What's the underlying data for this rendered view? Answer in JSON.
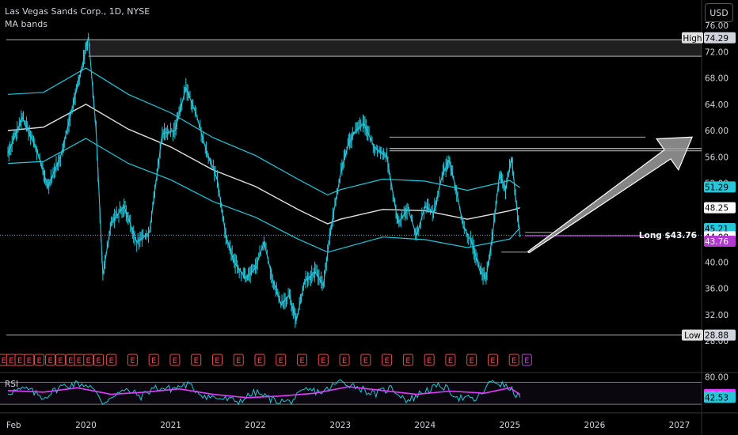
{
  "header": {
    "title": "Las Vegas Sands Corp., 1D, NYSE",
    "indicator": "MA bands",
    "currency_button": "USD"
  },
  "chart_data": {
    "type": "line",
    "instrument": "Las Vegas Sands Corp.",
    "interval": "1D",
    "exchange": "NYSE",
    "x_ticks": [
      "Feb",
      "2020",
      "2021",
      "2022",
      "2023",
      "2024",
      "2025",
      "2026",
      "2027"
    ],
    "y_ticks": [
      28.0,
      32.0,
      36.0,
      40.0,
      44.0,
      48.0,
      52.0,
      56.0,
      60.0,
      64.0,
      68.0,
      72.0,
      76.0
    ],
    "ylim": [
      27.5,
      78.5
    ],
    "price_series": {
      "name": "",
      "color": "#26c6da",
      "points": [
        [
          2019.08,
          56.5
        ],
        [
          2019.25,
          62.0
        ],
        [
          2019.42,
          57.0
        ],
        [
          2019.55,
          51.5
        ],
        [
          2019.7,
          56.0
        ],
        [
          2019.85,
          64.0
        ],
        [
          2019.96,
          70.0
        ],
        [
          2020.03,
          74.29
        ],
        [
          2020.12,
          60.0
        ],
        [
          2020.2,
          38.0
        ],
        [
          2020.3,
          46.0
        ],
        [
          2020.45,
          48.5
        ],
        [
          2020.6,
          43.0
        ],
        [
          2020.75,
          44.5
        ],
        [
          2020.9,
          59.5
        ],
        [
          2021.05,
          60.0
        ],
        [
          2021.18,
          66.5
        ],
        [
          2021.3,
          62.5
        ],
        [
          2021.42,
          57.0
        ],
        [
          2021.55,
          52.5
        ],
        [
          2021.65,
          44.0
        ],
        [
          2021.75,
          40.0
        ],
        [
          2021.88,
          37.5
        ],
        [
          2022.0,
          39.0
        ],
        [
          2022.1,
          43.0
        ],
        [
          2022.2,
          37.5
        ],
        [
          2022.3,
          33.5
        ],
        [
          2022.4,
          35.0
        ],
        [
          2022.48,
          31.0
        ],
        [
          2022.58,
          37.0
        ],
        [
          2022.7,
          38.5
        ],
        [
          2022.8,
          36.5
        ],
        [
          2022.9,
          46.0
        ],
        [
          2023.02,
          54.5
        ],
        [
          2023.1,
          58.0
        ],
        [
          2023.18,
          60.0
        ],
        [
          2023.28,
          61.0
        ],
        [
          2023.4,
          57.5
        ],
        [
          2023.55,
          56.0
        ],
        [
          2023.68,
          46.0
        ],
        [
          2023.8,
          48.0
        ],
        [
          2023.9,
          44.0
        ],
        [
          2024.0,
          48.5
        ],
        [
          2024.1,
          47.5
        ],
        [
          2024.2,
          53.0
        ],
        [
          2024.28,
          55.5
        ],
        [
          2024.36,
          51.5
        ],
        [
          2024.45,
          45.5
        ],
        [
          2024.55,
          43.0
        ],
        [
          2024.65,
          38.5
        ],
        [
          2024.72,
          37.5
        ],
        [
          2024.8,
          44.5
        ],
        [
          2024.88,
          53.5
        ],
        [
          2024.95,
          51.0
        ],
        [
          2025.02,
          56.0
        ],
        [
          2025.08,
          48.5
        ],
        [
          2025.12,
          43.76
        ]
      ]
    },
    "ma_bands": {
      "color_mid": "#e0e0e0",
      "color_band": "#26c6da",
      "points": [
        [
          2019.08,
          60.0,
          65.5,
          55.0
        ],
        [
          2019.5,
          60.5,
          65.8,
          55.3
        ],
        [
          2020.0,
          64.0,
          69.5,
          58.8
        ],
        [
          2020.5,
          60.2,
          65.5,
          55.0
        ],
        [
          2021.0,
          57.5,
          62.7,
          52.5
        ],
        [
          2021.5,
          54.0,
          58.9,
          49.2
        ],
        [
          2022.0,
          51.5,
          56.2,
          46.8
        ],
        [
          2022.5,
          48.0,
          52.6,
          43.5
        ],
        [
          2022.85,
          45.8,
          50.2,
          41.5
        ],
        [
          2023.0,
          46.5,
          51.0,
          42.0
        ],
        [
          2023.5,
          48.0,
          52.6,
          43.8
        ],
        [
          2024.0,
          47.8,
          52.3,
          43.4
        ],
        [
          2024.5,
          46.5,
          50.9,
          42.2
        ],
        [
          2025.0,
          47.8,
          52.4,
          43.5
        ],
        [
          2025.12,
          48.25,
          51.29,
          45.21
        ]
      ]
    },
    "horizontal_lines": [
      {
        "y": 73.8,
        "x_start": 2019.06,
        "x_end": 2027.3,
        "color": "#b0b0b0"
      },
      {
        "y": 71.3,
        "x_start": 2020.03,
        "x_end": 2027.3,
        "color": "#b0b0b0"
      },
      {
        "y": 59.0,
        "x_start": 2023.58,
        "x_end": 2026.6,
        "color": "#b0b0b0"
      },
      {
        "y": 57.3,
        "x_start": 2023.58,
        "x_end": 2027.3,
        "color": "#b0b0b0"
      },
      {
        "y": 56.9,
        "x_start": 2023.58,
        "x_end": 2027.3,
        "color": "#b0b0b0"
      },
      {
        "y": 44.5,
        "x_start": 2025.18,
        "x_end": 2025.5,
        "color": "#b0b0b0"
      },
      {
        "y": 41.5,
        "x_start": 2024.9,
        "x_end": 2025.25,
        "color": "#b0b0b0"
      },
      {
        "y": 28.88,
        "x_start": 2019.06,
        "x_end": 2027.3,
        "color": "#b0b0b0"
      }
    ],
    "current_price_line": {
      "y": 44.08,
      "color": "#26c6da"
    },
    "arrow": {
      "from": [
        2025.22,
        41.5
      ],
      "to": [
        2027.15,
        59.0
      ],
      "color": "#9e9e9e"
    },
    "position_marker": {
      "label": "Long $43.76",
      "y": 43.76,
      "x_start": 2025.18,
      "x_end": 2026.6,
      "color": "#b23ad3"
    },
    "price_labels": [
      {
        "value": "74.29",
        "prefix": "High",
        "bg": "#d1d4dc",
        "fg": "#000000"
      },
      {
        "value": "51.29",
        "prefix": "",
        "bg": "#26c6da",
        "fg": "#000000"
      },
      {
        "value": "48.25",
        "prefix": "",
        "bg": "#ffffff",
        "fg": "#000000"
      },
      {
        "value": "45.21",
        "prefix": "",
        "bg": "#26c6da",
        "fg": "#000000"
      },
      {
        "value": "44.08",
        "prefix": "",
        "bg": "#ffffff",
        "fg": "#000000"
      },
      {
        "value": "43.76",
        "prefix": "",
        "bg": "#b23ad3",
        "fg": "#ffffff"
      },
      {
        "value": "28.88",
        "prefix": "Low",
        "bg": "#d1d4dc",
        "fg": "#000000"
      }
    ],
    "earnings_markers": {
      "label": "E",
      "color": "#e05050",
      "highlight_color": "#c040e0",
      "x": [
        2019.03,
        2019.12,
        2019.22,
        2019.33,
        2019.45,
        2019.58,
        2019.7,
        2019.82,
        2019.92,
        2020.03,
        2020.15,
        2020.3,
        2020.55,
        2020.8,
        2021.05,
        2021.3,
        2021.55,
        2021.8,
        2022.05,
        2022.3,
        2022.55,
        2022.8,
        2023.05,
        2023.3,
        2023.55,
        2023.8,
        2024.05,
        2024.3,
        2024.55,
        2024.8,
        2025.05,
        2025.2
      ],
      "highlight_last": true
    },
    "rsi": {
      "label": "RSI",
      "y_ticks": [
        80.0
      ],
      "ylim": [
        20,
        85
      ],
      "levels": [
        70,
        30
      ],
      "rsi_color": "#26c6da",
      "ma_color": "#e040fb",
      "points": [
        [
          2019.08,
          52
        ],
        [
          2019.3,
          58
        ],
        [
          2019.5,
          42
        ],
        [
          2019.7,
          62
        ],
        [
          2019.9,
          68
        ],
        [
          2020.05,
          64
        ],
        [
          2020.2,
          32
        ],
        [
          2020.35,
          50
        ],
        [
          2020.5,
          55
        ],
        [
          2020.65,
          44
        ],
        [
          2020.8,
          60
        ],
        [
          2021.0,
          58
        ],
        [
          2021.2,
          66
        ],
        [
          2021.4,
          45
        ],
        [
          2021.6,
          40
        ],
        [
          2021.8,
          35
        ],
        [
          2022.0,
          52
        ],
        [
          2022.2,
          38
        ],
        [
          2022.4,
          34
        ],
        [
          2022.6,
          56
        ],
        [
          2022.8,
          52
        ],
        [
          2023.0,
          72
        ],
        [
          2023.2,
          62
        ],
        [
          2023.4,
          48
        ],
        [
          2023.6,
          60
        ],
        [
          2023.8,
          36
        ],
        [
          2024.0,
          55
        ],
        [
          2024.2,
          64
        ],
        [
          2024.4,
          42
        ],
        [
          2024.6,
          38
        ],
        [
          2024.8,
          74
        ],
        [
          2025.0,
          58
        ],
        [
          2025.12,
          42.53
        ]
      ],
      "ma_points": [
        [
          2019.08,
          55
        ],
        [
          2019.5,
          52
        ],
        [
          2019.9,
          60
        ],
        [
          2020.3,
          48
        ],
        [
          2020.7,
          52
        ],
        [
          2021.1,
          58
        ],
        [
          2021.5,
          48
        ],
        [
          2021.9,
          42
        ],
        [
          2022.3,
          45
        ],
        [
          2022.7,
          50
        ],
        [
          2023.1,
          62
        ],
        [
          2023.5,
          55
        ],
        [
          2023.9,
          48
        ],
        [
          2024.3,
          54
        ],
        [
          2024.7,
          50
        ],
        [
          2025.0,
          60
        ],
        [
          2025.12,
          47.79
        ]
      ],
      "labels": [
        {
          "value": "47.79",
          "bg": "#e040fb",
          "fg": "#ffffff"
        },
        {
          "value": "42.53",
          "bg": "#26c6da",
          "fg": "#000000"
        }
      ]
    }
  }
}
